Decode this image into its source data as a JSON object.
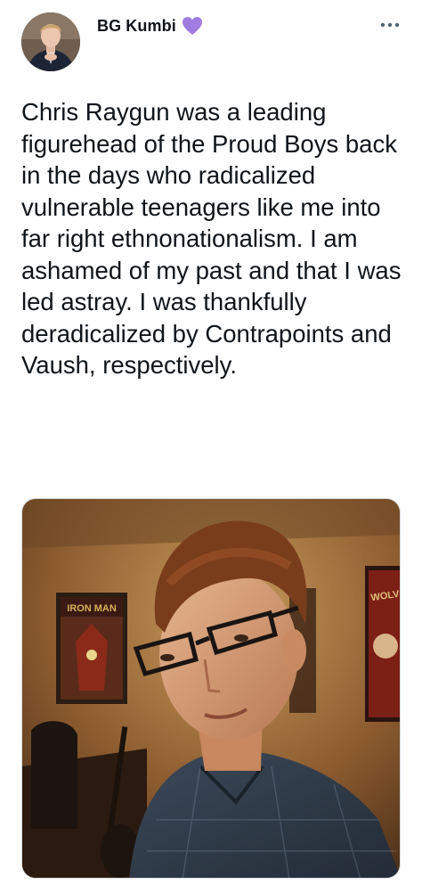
{
  "author": {
    "display_name": "BG Kumbi",
    "badge_icon": "purple-heart-icon",
    "badge_color": "#a07ce0"
  },
  "menu": {
    "more_icon": "more-horizontal-icon"
  },
  "tweet": {
    "text": "Chris Raygun was a leading figurehead of the Proud Boys back in the days who radicalized vulnerable teenagers like me into far right ethnonationalism. I am ashamed of my past and that I was led astray. I was thankfully deradicalized by Contrapoints and Vaush, respectively."
  },
  "media": {
    "poster_left": "IRON MAN",
    "poster_right": "WOLV"
  }
}
